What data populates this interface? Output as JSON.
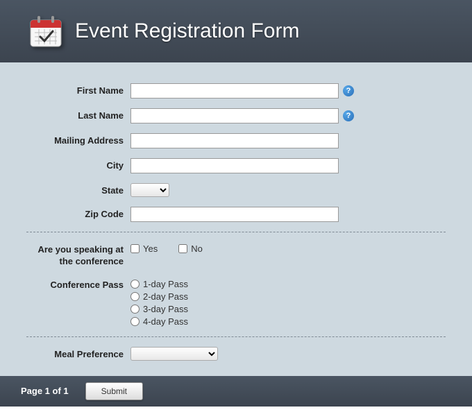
{
  "header": {
    "title": "Event Registration Form"
  },
  "form": {
    "fields": {
      "first_name": {
        "label": "First Name",
        "value": "",
        "help": "?"
      },
      "last_name": {
        "label": "Last Name",
        "value": "",
        "help": "?"
      },
      "mailing_address": {
        "label": "Mailing Address",
        "value": ""
      },
      "city": {
        "label": "City",
        "value": ""
      },
      "state": {
        "label": "State",
        "value": ""
      },
      "zip_code": {
        "label": "Zip Code",
        "value": ""
      }
    },
    "speaking": {
      "label": "Are you speaking at the conference",
      "options": {
        "yes": "Yes",
        "no": "No"
      }
    },
    "pass": {
      "label": "Conference Pass",
      "options": [
        "1-day Pass",
        "2-day Pass",
        "3-day Pass",
        "4-day Pass"
      ]
    },
    "meal": {
      "label": "Meal Preference",
      "value": ""
    }
  },
  "footer": {
    "page": "Page 1 of 1",
    "submit": "Submit"
  }
}
